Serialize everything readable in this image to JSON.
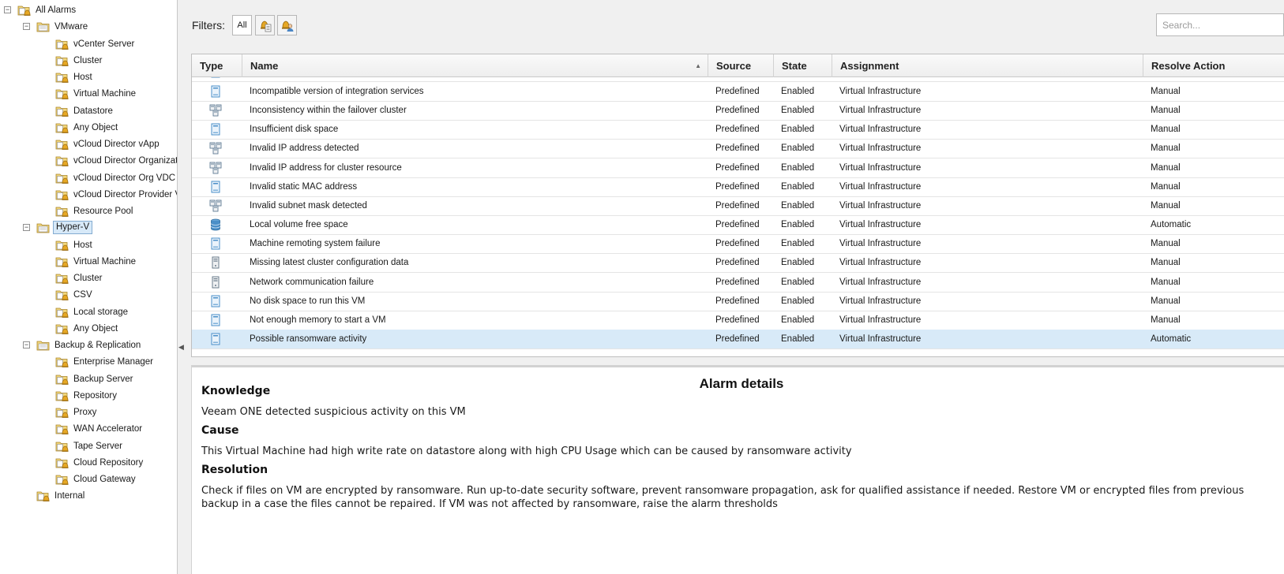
{
  "tree": [
    {
      "label": "All Alarms",
      "level": 0,
      "expander": "minus",
      "icon": "alarm-folder-icon"
    },
    {
      "label": "VMware",
      "level": 1,
      "expander": "minus",
      "icon": "folder-icon"
    },
    {
      "label": "vCenter Server",
      "level": 2,
      "icon": "alarm-folder-icon"
    },
    {
      "label": "Cluster",
      "level": 2,
      "icon": "alarm-folder-icon"
    },
    {
      "label": "Host",
      "level": 2,
      "icon": "alarm-folder-icon"
    },
    {
      "label": "Virtual Machine",
      "level": 2,
      "icon": "alarm-folder-icon"
    },
    {
      "label": "Datastore",
      "level": 2,
      "icon": "alarm-folder-icon"
    },
    {
      "label": "Any Object",
      "level": 2,
      "icon": "alarm-folder-icon"
    },
    {
      "label": "vCloud Director vApp",
      "level": 2,
      "icon": "alarm-folder-icon"
    },
    {
      "label": "vCloud Director Organizatio",
      "level": 2,
      "icon": "alarm-folder-icon"
    },
    {
      "label": "vCloud Director Org VDC",
      "level": 2,
      "icon": "alarm-folder-icon"
    },
    {
      "label": "vCloud Director Provider VD",
      "level": 2,
      "icon": "alarm-folder-icon"
    },
    {
      "label": "Resource Pool",
      "level": 2,
      "icon": "alarm-folder-icon"
    },
    {
      "label": "Hyper-V",
      "level": 1,
      "expander": "minus",
      "icon": "folder-icon",
      "selected": true
    },
    {
      "label": "Host",
      "level": 2,
      "icon": "alarm-folder-icon"
    },
    {
      "label": "Virtual Machine",
      "level": 2,
      "icon": "alarm-folder-icon"
    },
    {
      "label": "Cluster",
      "level": 2,
      "icon": "alarm-folder-icon"
    },
    {
      "label": "CSV",
      "level": 2,
      "icon": "alarm-folder-icon"
    },
    {
      "label": "Local storage",
      "level": 2,
      "icon": "alarm-folder-icon"
    },
    {
      "label": "Any Object",
      "level": 2,
      "icon": "alarm-folder-icon"
    },
    {
      "label": "Backup & Replication",
      "level": 1,
      "expander": "minus",
      "icon": "folder-icon"
    },
    {
      "label": "Enterprise Manager",
      "level": 2,
      "icon": "alarm-folder-icon"
    },
    {
      "label": "Backup Server",
      "level": 2,
      "icon": "alarm-folder-icon"
    },
    {
      "label": "Repository",
      "level": 2,
      "icon": "alarm-folder-icon"
    },
    {
      "label": "Proxy",
      "level": 2,
      "icon": "alarm-folder-icon"
    },
    {
      "label": "WAN Accelerator",
      "level": 2,
      "icon": "alarm-folder-icon"
    },
    {
      "label": "Tape Server",
      "level": 2,
      "icon": "alarm-folder-icon"
    },
    {
      "label": "Cloud Repository",
      "level": 2,
      "icon": "alarm-folder-icon"
    },
    {
      "label": "Cloud Gateway",
      "level": 2,
      "icon": "alarm-folder-icon"
    },
    {
      "label": "Internal",
      "level": 1,
      "icon": "alarm-folder-icon"
    }
  ],
  "filters": {
    "label": "Filters:",
    "all_label": "All",
    "button_a_icon": "alarm-filter-icon",
    "button_b_icon": "user-alarm-filter-icon"
  },
  "search": {
    "placeholder": "Search..."
  },
  "grid": {
    "columns": [
      "Type",
      "Name",
      "Source",
      "State",
      "Assignment",
      "Resolve Action"
    ],
    "sorted_column": "Name",
    "sort_direction": "ascending",
    "rows": [
      {
        "icon": "vm-icon",
        "name": "Incompatible version of integration services",
        "source": "Predefined",
        "state": "Enabled",
        "assignment": "Virtual Infrastructure",
        "resolve": "Manual"
      },
      {
        "icon": "cluster-icon",
        "name": "Inconsistency within the failover cluster",
        "source": "Predefined",
        "state": "Enabled",
        "assignment": "Virtual Infrastructure",
        "resolve": "Manual"
      },
      {
        "icon": "vm-icon",
        "name": "Insufficient disk space",
        "source": "Predefined",
        "state": "Enabled",
        "assignment": "Virtual Infrastructure",
        "resolve": "Manual"
      },
      {
        "icon": "cluster-icon",
        "name": "Invalid IP address detected",
        "source": "Predefined",
        "state": "Enabled",
        "assignment": "Virtual Infrastructure",
        "resolve": "Manual"
      },
      {
        "icon": "cluster-icon",
        "name": "Invalid IP address for cluster resource",
        "source": "Predefined",
        "state": "Enabled",
        "assignment": "Virtual Infrastructure",
        "resolve": "Manual"
      },
      {
        "icon": "vm-icon",
        "name": "Invalid static MAC address",
        "source": "Predefined",
        "state": "Enabled",
        "assignment": "Virtual Infrastructure",
        "resolve": "Manual"
      },
      {
        "icon": "cluster-icon",
        "name": "Invalid subnet mask detected",
        "source": "Predefined",
        "state": "Enabled",
        "assignment": "Virtual Infrastructure",
        "resolve": "Manual"
      },
      {
        "icon": "storage-icon",
        "name": "Local volume free space",
        "source": "Predefined",
        "state": "Enabled",
        "assignment": "Virtual Infrastructure",
        "resolve": "Automatic"
      },
      {
        "icon": "vm-icon",
        "name": "Machine remoting system failure",
        "source": "Predefined",
        "state": "Enabled",
        "assignment": "Virtual Infrastructure",
        "resolve": "Manual"
      },
      {
        "icon": "host-icon",
        "name": "Missing latest cluster configuration data",
        "source": "Predefined",
        "state": "Enabled",
        "assignment": "Virtual Infrastructure",
        "resolve": "Manual"
      },
      {
        "icon": "host-icon",
        "name": "Network communication failure",
        "source": "Predefined",
        "state": "Enabled",
        "assignment": "Virtual Infrastructure",
        "resolve": "Manual"
      },
      {
        "icon": "vm-icon",
        "name": "No disk space to run this VM",
        "source": "Predefined",
        "state": "Enabled",
        "assignment": "Virtual Infrastructure",
        "resolve": "Manual"
      },
      {
        "icon": "vm-icon",
        "name": "Not enough memory to start a VM",
        "source": "Predefined",
        "state": "Enabled",
        "assignment": "Virtual Infrastructure",
        "resolve": "Manual"
      },
      {
        "icon": "vm-icon",
        "name": "Possible ransomware activity",
        "source": "Predefined",
        "state": "Enabled",
        "assignment": "Virtual Infrastructure",
        "resolve": "Automatic",
        "selected": true
      }
    ]
  },
  "details": {
    "title": "Alarm details",
    "knowledge_heading": "Knowledge",
    "knowledge_text": "Veeam ONE detected suspicious activity on this VM",
    "cause_heading": "Cause",
    "cause_text": "This Virtual Machine had high write rate on datastore along with high CPU Usage which can be caused by ransomware activity",
    "resolution_heading": "Resolution",
    "resolution_text": "Check if files on VM are encrypted by ransomware. Run up-to-date security software, prevent ransomware propagation, ask for qualified assistance if needed. Restore VM or encrypted files from previous backup in a case the files cannot be repaired. If VM was not affected by ransomware, raise the alarm thresholds"
  },
  "colors": {
    "selection": "#d8eaf8",
    "pane_background": "#f0f0f0",
    "folder": "#e8c35a",
    "bell": "#e0a020",
    "vm_icon": "#4a8fc8"
  }
}
